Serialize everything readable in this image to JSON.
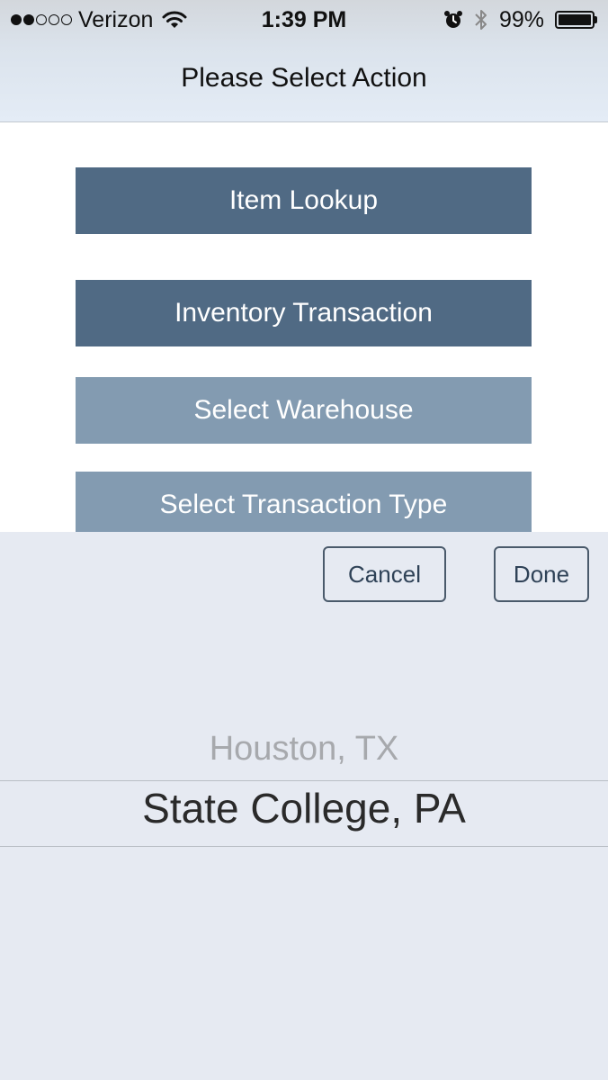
{
  "status_bar": {
    "carrier": "Verizon",
    "time": "1:39 PM",
    "battery_percent": "99%",
    "battery_level": 0.99,
    "signal_bars_filled": 2,
    "signal_bars_total": 5,
    "icons": [
      "signal-dots-icon",
      "wifi-icon",
      "alarm-icon",
      "bluetooth-icon",
      "battery-icon"
    ]
  },
  "nav": {
    "title": "Please Select Action"
  },
  "actions": {
    "item_lookup": "Item Lookup",
    "inventory_transaction": "Inventory Transaction",
    "select_warehouse": "Select Warehouse",
    "select_transaction_type": "Select Transaction Type"
  },
  "picker": {
    "cancel_label": "Cancel",
    "done_label": "Done",
    "options": [
      "Houston, TX",
      "State College, PA"
    ],
    "selected": "State College, PA"
  },
  "colors": {
    "primary_button": "#506a84",
    "secondary_button": "#839bb1",
    "picker_background": "#e6eaf2"
  }
}
